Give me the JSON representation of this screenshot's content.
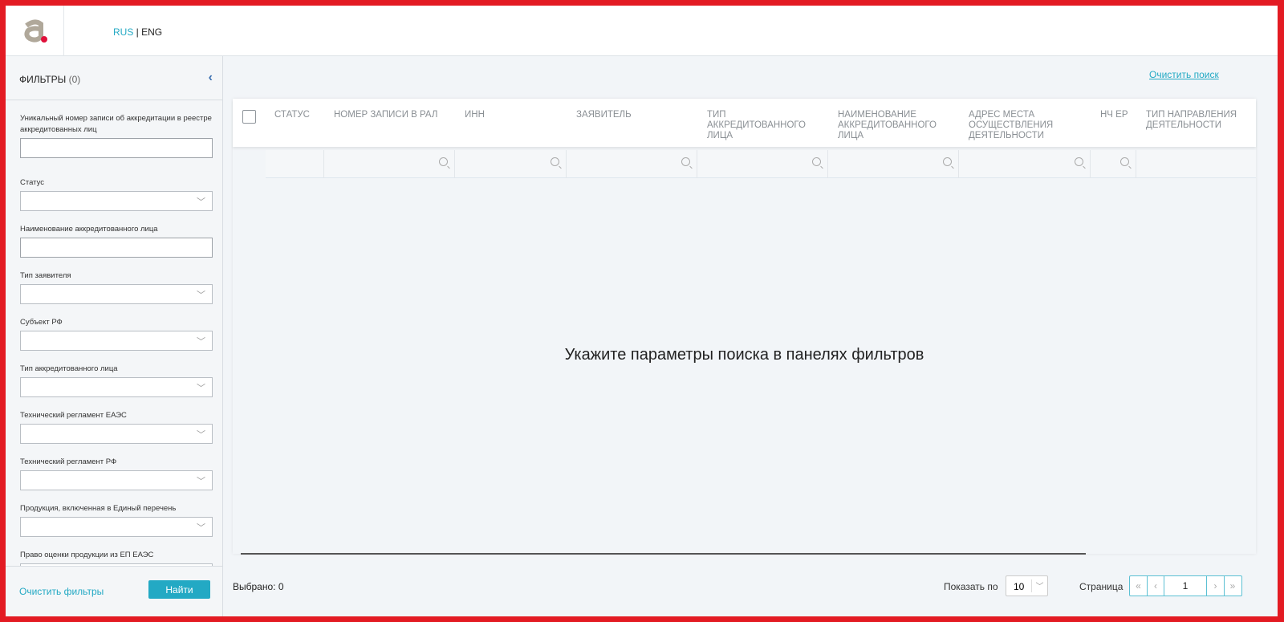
{
  "header": {
    "lang_rus": "RUS",
    "lang_sep": " | ",
    "lang_eng": "ENG"
  },
  "sidebar": {
    "title": "ФИЛЬТРЫ",
    "count": "(0)",
    "collapse": "‹",
    "fields": [
      {
        "label": "Уникальный номер записи об аккредитации в реестре аккредитованных лиц",
        "type": "text"
      },
      {
        "label": "Статус",
        "type": "select"
      },
      {
        "label": "Наименование аккредитованного лица",
        "type": "text"
      },
      {
        "label": "Тип заявителя",
        "type": "select"
      },
      {
        "label": "Субъект РФ",
        "type": "select"
      },
      {
        "label": "Тип аккредитованного лица",
        "type": "select"
      },
      {
        "label": "Технический регламент ЕАЭС",
        "type": "select"
      },
      {
        "label": "Технический регламент РФ",
        "type": "select"
      },
      {
        "label": "Продукция, включенная в Единый перечень",
        "type": "select"
      },
      {
        "label": "Право оценки продукции из ЕП ЕАЭС",
        "type": "select"
      }
    ],
    "clear_filters": "Очистить фильтры",
    "find": "Найти"
  },
  "main": {
    "clear_search": "Очистить поиск",
    "columns": [
      "Статус",
      "Номер записи в РАЛ",
      "ИНН",
      "Заявитель",
      "Тип аккредитованного лица",
      "Наименование аккредитованного лица",
      "Адрес места осуществления деятельности",
      "НЧ ЕР",
      "Тип направления деятельности"
    ],
    "empty_message": "Укажите параметры поиска в панелях фильтров",
    "selected": "Выбрано: 0",
    "show_label": "Показать по",
    "per_page": "10",
    "page_label": "Страница",
    "page": "1"
  }
}
